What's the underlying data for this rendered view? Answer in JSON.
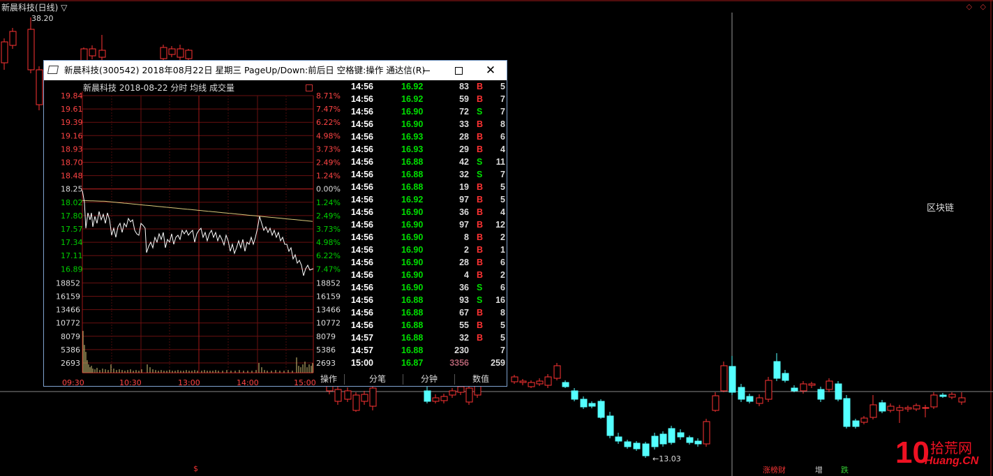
{
  "background_chart": {
    "title": "新晨科技(日线) ▽",
    "high_label": "38.20",
    "low_label": "←13.03",
    "annotation": "区块链",
    "bottom_tags": [
      "涨榜财",
      "增",
      "跌"
    ],
    "dollar_mark": "$",
    "corner_icons": "◇ ◇",
    "colors": {
      "up": "#ff3333",
      "down": "#54ffff"
    }
  },
  "watermark": {
    "number": "10",
    "cn": "拾荒网",
    "en": "Huang.CN"
  },
  "popup": {
    "title": "新晨科技(300542) 2018年08月22日 星期三 PageUp/Down:前后日 空格键:操作 通达信(R)",
    "window_buttons": {
      "minimize": "minimize",
      "maximize": "maximize",
      "close": "✕"
    },
    "chart_header": "新晨科技    2018-08-22 分时 均线 成交量",
    "price_axis_left": [
      "19.84",
      "19.61",
      "19.39",
      "19.16",
      "18.93",
      "18.70",
      "18.48",
      "18.25",
      "18.02",
      "17.80",
      "17.57",
      "17.34",
      "17.11",
      "16.89"
    ],
    "pct_axis_right": [
      "8.71%",
      "7.47%",
      "6.22%",
      "4.98%",
      "3.73%",
      "2.49%",
      "1.24%",
      "0.00%",
      "1.24%",
      "2.49%",
      "3.73%",
      "4.98%",
      "6.22%",
      "7.47%"
    ],
    "volume_axis": [
      "18852",
      "16159",
      "13466",
      "10772",
      "8079",
      "5386",
      "2693"
    ],
    "time_axis": [
      "09:30",
      "10:30",
      "13:00",
      "14:00",
      "15:00"
    ],
    "ticks": [
      {
        "time": "14:56",
        "price": "16.92",
        "vol": "83",
        "bs": "B",
        "n": "5"
      },
      {
        "time": "14:56",
        "price": "16.92",
        "vol": "59",
        "bs": "B",
        "n": "7"
      },
      {
        "time": "14:56",
        "price": "16.90",
        "vol": "72",
        "bs": "S",
        "n": "7"
      },
      {
        "time": "14:56",
        "price": "16.90",
        "vol": "33",
        "bs": "B",
        "n": "8"
      },
      {
        "time": "14:56",
        "price": "16.93",
        "vol": "28",
        "bs": "B",
        "n": "6"
      },
      {
        "time": "14:56",
        "price": "16.93",
        "vol": "29",
        "bs": "B",
        "n": "4"
      },
      {
        "time": "14:56",
        "price": "16.88",
        "vol": "42",
        "bs": "S",
        "n": "11"
      },
      {
        "time": "14:56",
        "price": "16.88",
        "vol": "32",
        "bs": "S",
        "n": "7"
      },
      {
        "time": "14:56",
        "price": "16.88",
        "vol": "19",
        "bs": "B",
        "n": "5"
      },
      {
        "time": "14:56",
        "price": "16.92",
        "vol": "97",
        "bs": "B",
        "n": "5"
      },
      {
        "time": "14:56",
        "price": "16.90",
        "vol": "36",
        "bs": "B",
        "n": "4"
      },
      {
        "time": "14:56",
        "price": "16.90",
        "vol": "97",
        "bs": "B",
        "n": "12"
      },
      {
        "time": "14:56",
        "price": "16.90",
        "vol": "8",
        "bs": "B",
        "n": "2"
      },
      {
        "time": "14:56",
        "price": "16.90",
        "vol": "2",
        "bs": "B",
        "n": "1"
      },
      {
        "time": "14:56",
        "price": "16.90",
        "vol": "28",
        "bs": "B",
        "n": "6"
      },
      {
        "time": "14:56",
        "price": "16.90",
        "vol": "4",
        "bs": "B",
        "n": "2"
      },
      {
        "time": "14:56",
        "price": "16.90",
        "vol": "36",
        "bs": "S",
        "n": "6"
      },
      {
        "time": "14:56",
        "price": "16.88",
        "vol": "93",
        "bs": "S",
        "n": "16"
      },
      {
        "time": "14:56",
        "price": "16.88",
        "vol": "67",
        "bs": "B",
        "n": "8"
      },
      {
        "time": "14:56",
        "price": "16.88",
        "vol": "55",
        "bs": "B",
        "n": "5"
      },
      {
        "time": "14:57",
        "price": "16.88",
        "vol": "32",
        "bs": "B",
        "n": "5"
      },
      {
        "time": "14:57",
        "price": "16.88",
        "vol": "230",
        "bs": "",
        "n": "7"
      },
      {
        "time": "15:00",
        "price": "16.87",
        "vol": "3356",
        "bs": "",
        "n": "259"
      }
    ],
    "tabs": [
      "操作",
      "分笔",
      "分钟",
      "数值"
    ]
  }
}
